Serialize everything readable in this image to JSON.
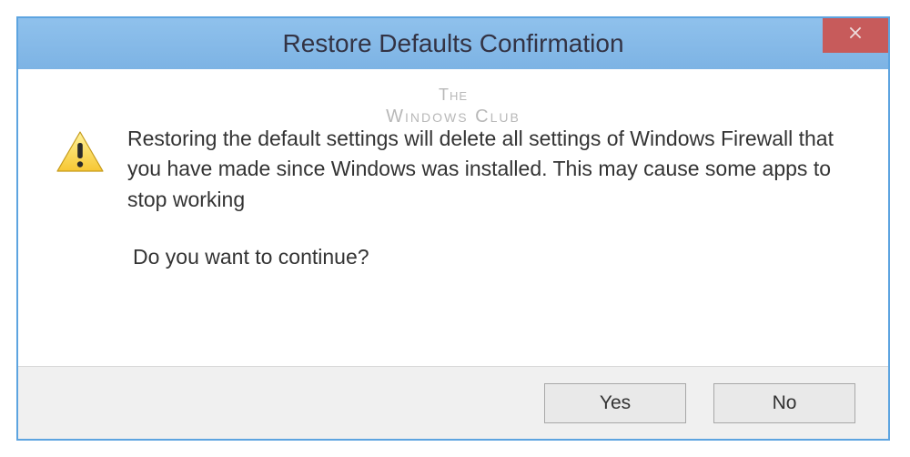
{
  "titlebar": {
    "title": "Restore Defaults Confirmation"
  },
  "watermark": {
    "line1": "The",
    "line2": "Windows Club"
  },
  "message": {
    "para1": "Restoring the default settings will delete all settings of Windows Firewall that you have made since Windows was installed. This may cause some apps to stop working",
    "para2": "Do you want to continue?"
  },
  "buttons": {
    "yes": "Yes",
    "no": "No"
  },
  "colors": {
    "titlebar_bg": "#85b9e8",
    "close_bg": "#c75b5b",
    "border": "#5da4e0"
  }
}
